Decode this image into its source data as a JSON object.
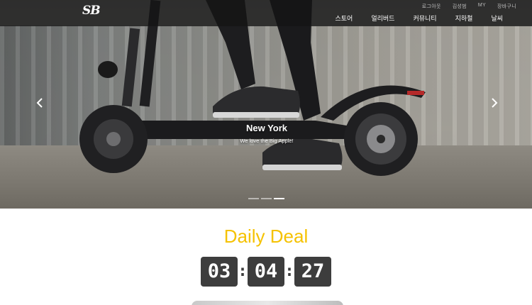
{
  "brand": {
    "logo_text": "SB"
  },
  "util_nav": [
    "로그아웃",
    "김성범",
    "MY",
    "장바구니"
  ],
  "main_nav": [
    "스토어",
    "얼리버드",
    "커뮤니티",
    "지하철",
    "날씨"
  ],
  "carousel": {
    "caption_title": "New York",
    "caption_subtitle": "We love the Big Apple!",
    "prev_icon": "chevron-left-icon",
    "next_icon": "chevron-right-icon",
    "slide_count": 3,
    "active_index": 2
  },
  "deal": {
    "title": "Daily Deal",
    "hours": "03",
    "minutes": "04",
    "seconds": "27",
    "separator": ":"
  },
  "colors": {
    "accent": "#f5c200",
    "countdown_bg": "#3d3d3d",
    "navbar_bg": "#141414"
  }
}
